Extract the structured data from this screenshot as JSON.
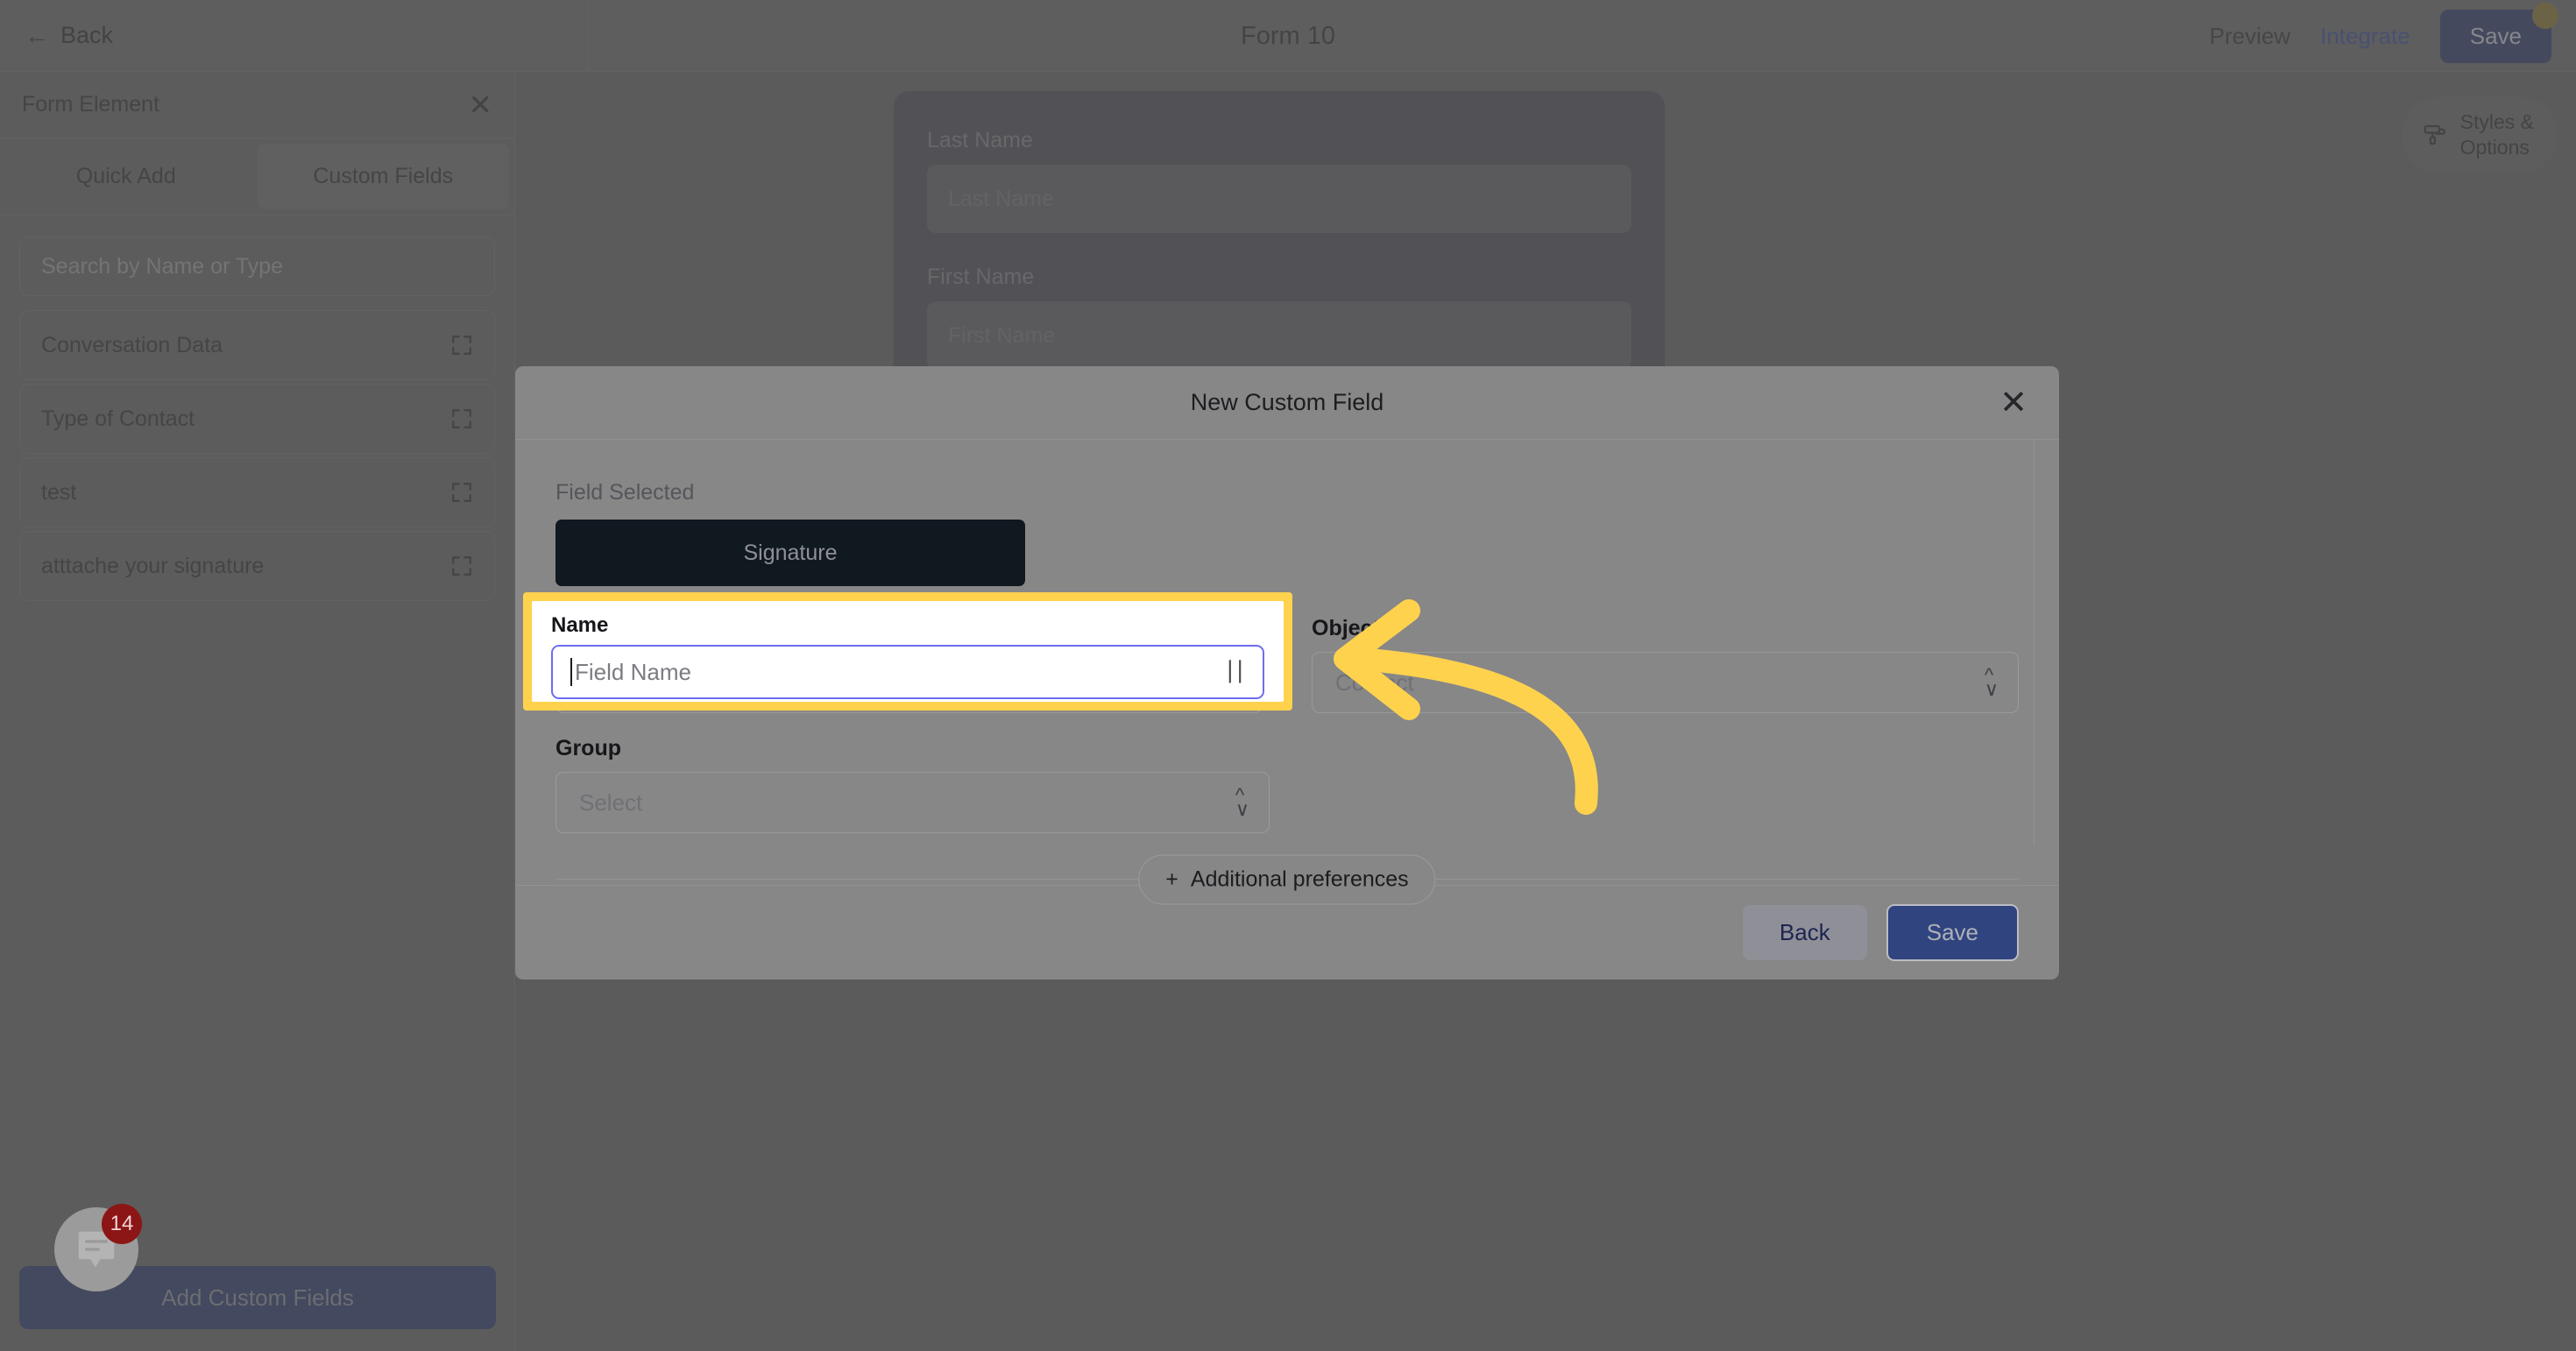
{
  "topbar": {
    "back_label": "Back",
    "title": "Form 10",
    "preview_label": "Preview",
    "integrate_label": "Integrate",
    "save_label": "Save"
  },
  "sidebar": {
    "panel_title": "Form Element",
    "tabs": [
      {
        "label": "Quick Add",
        "active": false
      },
      {
        "label": "Custom Fields",
        "active": true
      }
    ],
    "search_placeholder": "Search by Name or Type",
    "items": [
      {
        "label": "Conversation Data"
      },
      {
        "label": "Type of Contact"
      },
      {
        "label": "test"
      },
      {
        "label": "atttache your signature"
      }
    ],
    "footer_button": "Add Custom Fields"
  },
  "canvas": {
    "styles_button_line1": "Styles &",
    "styles_button_line2": "Options",
    "form_fields": [
      {
        "label": "Last Name",
        "placeholder": "Last Name"
      },
      {
        "label": "First Name",
        "placeholder": "First Name"
      }
    ]
  },
  "modal": {
    "title": "New Custom Field",
    "field_selected_label": "Field Selected",
    "selected_field_chip": "Signature",
    "name": {
      "label": "Name",
      "placeholder": "Field Name",
      "value": ""
    },
    "object": {
      "label": "Object",
      "value": "Contact"
    },
    "group": {
      "label": "Group",
      "placeholder": "Select"
    },
    "additional_preferences_label": "Additional preferences",
    "additional_preferences_plus": "+",
    "back_label": "Back",
    "save_label": "Save"
  },
  "chat": {
    "badge_count": "14"
  },
  "colors": {
    "highlight": "#FFD24D",
    "arrow": "#FFD24D",
    "focus_border": "#6f6cf0",
    "primary_navy": "#101c42",
    "save_blue": "#30447f",
    "badge_red": "#8c1515"
  }
}
